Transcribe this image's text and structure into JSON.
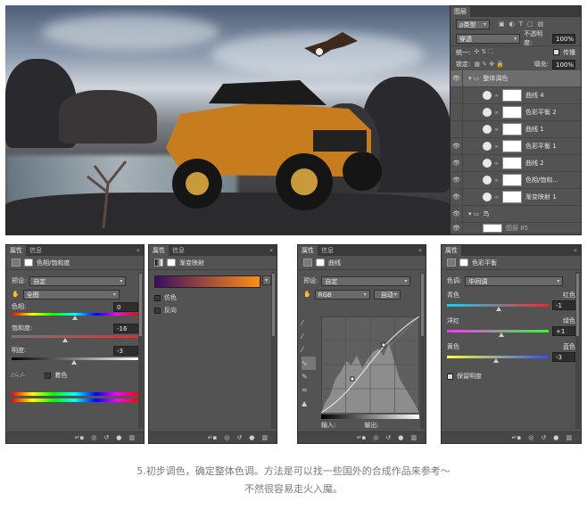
{
  "layers_panel": {
    "tab": "图层",
    "filter_kind": "ρ类型",
    "blend_mode": "穿透",
    "opacity_label": "不透明度:",
    "opacity_value": "100%",
    "unify_label": "统一:",
    "propagate_label": "传播",
    "lock_label": "锁定:",
    "fill_label": "填充:",
    "fill_value": "100%",
    "layers": [
      {
        "name": "整体调色",
        "type": "group",
        "visible": true
      },
      {
        "name": "曲线 4",
        "type": "adj",
        "visible": false
      },
      {
        "name": "色彩平衡 2",
        "type": "adj",
        "visible": false
      },
      {
        "name": "曲线 1",
        "type": "adj",
        "visible": false
      },
      {
        "name": "色彩平衡 1",
        "type": "adj",
        "visible": true
      },
      {
        "name": "曲线 2",
        "type": "adj",
        "visible": true
      },
      {
        "name": "色相/饱和...",
        "type": "adj",
        "visible": true
      },
      {
        "name": "渐变映射 1",
        "type": "adj",
        "visible": true
      },
      {
        "name": "鸟",
        "type": "group",
        "visible": true
      },
      {
        "name": "图层 85",
        "type": "adj",
        "visible": true
      }
    ]
  },
  "hue_sat": {
    "tabs": [
      "属性",
      "信息"
    ],
    "title": "色相/饱和度",
    "preset_label": "预设:",
    "preset_value": "自定",
    "channel_value": "全图",
    "hue_label": "色相:",
    "hue_value": "0",
    "sat_label": "饱和度:",
    "sat_value": "-16",
    "light_label": "明度:",
    "light_value": "-3",
    "colorize_label": "着色"
  },
  "gradient_map": {
    "tabs": [
      "属性",
      "信息"
    ],
    "title": "渐变映射",
    "gradient_start": "#3a0f5e",
    "gradient_end": "#ff8c1a",
    "dither_label": "仿色",
    "reverse_label": "反向"
  },
  "curves": {
    "tabs": [
      "属性",
      "信息"
    ],
    "title": "曲线",
    "preset_label": "预设:",
    "preset_value": "自定",
    "channel_value": "RGB",
    "auto_label": "自动",
    "input_label": "输入:",
    "output_label": "输出:"
  },
  "color_balance": {
    "tabs": [
      "属性"
    ],
    "title": "色彩平衡",
    "tone_label": "色调:",
    "tone_value": "中间调",
    "cyan": "青色",
    "red": "红色",
    "cr_value": "-1",
    "magenta": "洋红",
    "green": "绿色",
    "mg_value": "+1",
    "yellow": "黄色",
    "blue": "蓝色",
    "yb_value": "-3",
    "preserve_label": "保留明度"
  },
  "caption": {
    "line1": "5.初步调色，确定整体色调。方法是可以找一些国外的合成作品来参考～",
    "line2": "不然很容易走火入魔。"
  }
}
